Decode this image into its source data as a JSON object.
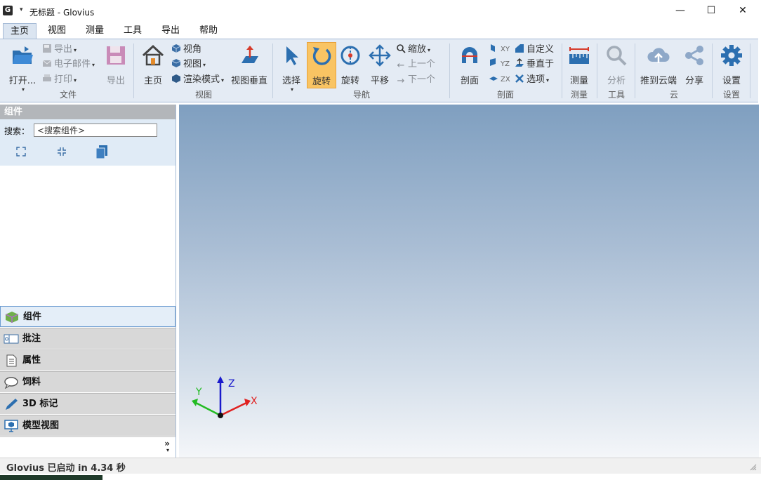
{
  "window": {
    "title": "无标题 - Glovius",
    "app_icon_letter": "G",
    "minimize": "—",
    "maximize": "☐",
    "close": "✕"
  },
  "menu": {
    "tabs": [
      "主页",
      "视图",
      "测量",
      "工具",
      "导出",
      "帮助"
    ],
    "active_tab": "主页"
  },
  "ribbon": {
    "file": {
      "open": "打开...",
      "export": "导出",
      "email": "电子邮件",
      "print": "打印",
      "save": "导出",
      "label": "文件"
    },
    "view": {
      "home": "主页",
      "angle": "视角",
      "view": "视图",
      "render_mode": "渲染模式",
      "perpendicular": "视图垂直",
      "label": "视图"
    },
    "nav": {
      "select": "选择",
      "rotate_active": "旋转",
      "rotate": "旋转",
      "pan": "平移",
      "zoom": "缩放",
      "prev": "上一个",
      "next": "下一个",
      "label": "导航"
    },
    "section": {
      "section": "剖面",
      "xy": "XY",
      "yz": "YZ",
      "zx": "ZX",
      "custom": "自定义",
      "perpendicular": "垂直于",
      "options": "选项",
      "label": "剖面"
    },
    "measure": {
      "measure": "测量",
      "label": "测量"
    },
    "tools": {
      "analyze": "分析",
      "label": "工具"
    },
    "cloud": {
      "push": "推到云端",
      "share": "分享",
      "label": "云"
    },
    "settings": {
      "settings": "设置",
      "label": "设置"
    }
  },
  "left_panel": {
    "header": "组件",
    "search_label": "搜索：",
    "search_placeholder": "<搜索组件>",
    "nav_items": [
      "组件",
      "批注",
      "属性",
      "饲料",
      "3D 标记",
      "模型视图"
    ],
    "active_item": "组件",
    "more": "»"
  },
  "triad": {
    "x": "X",
    "y": "Y",
    "z": "Z"
  },
  "status": {
    "text": "Glovius  已启动 in 4.34 秒"
  },
  "colors": {
    "accent": "#f9c463",
    "ribbon_bg": "#e4ebf4",
    "viewport_top": "#7f9fc0",
    "viewport_bottom": "#f4f6f9",
    "axis_x": "#e02020",
    "axis_y": "#22bb22",
    "axis_z": "#1a1acc"
  }
}
